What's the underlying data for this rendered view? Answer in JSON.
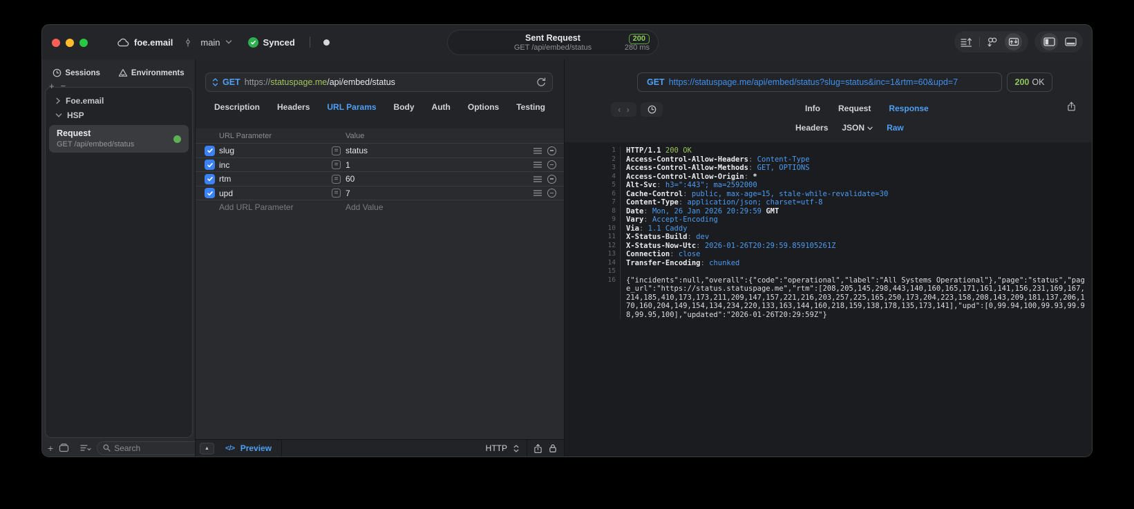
{
  "titlebar": {
    "project": "foe.email",
    "branch": "main",
    "sync_label": "Synced",
    "summary": {
      "title": "Sent Request",
      "subtitle": "GET /api/embed/status",
      "status_code": "200",
      "duration": "280 ms"
    }
  },
  "glyphs": {
    "plus": "+",
    "minus": "−",
    "equals": "=",
    "back": "‹",
    "forward": "›",
    "expand": "▲",
    "code_icon": "</>"
  },
  "sidebar": {
    "tabs": [
      {
        "label": "Sessions"
      },
      {
        "label": "Environments"
      }
    ],
    "active_tab": "Sessions",
    "tree": [
      {
        "label": "Foe.email"
      },
      {
        "label": "HSP"
      }
    ],
    "request_item": {
      "title": "Request",
      "subtitle": "GET /api/embed/status"
    },
    "search_placeholder": "Search"
  },
  "request_panel": {
    "method": "GET",
    "url": {
      "scheme": "https://",
      "host": "statuspage.me",
      "path": "/api/embed/status"
    },
    "tabs": [
      "Description",
      "Headers",
      "URL Params",
      "Body",
      "Auth",
      "Options",
      "Testing"
    ],
    "active_tab": "URL Params",
    "params": {
      "columns": [
        "URL Parameter",
        "Value"
      ],
      "rows": [
        {
          "name": "slug",
          "value": "status",
          "enabled": true
        },
        {
          "name": "inc",
          "value": "1",
          "enabled": true
        },
        {
          "name": "rtm",
          "value": "60",
          "enabled": true
        },
        {
          "name": "upd",
          "value": "7",
          "enabled": true
        }
      ],
      "add_name_placeholder": "Add URL Parameter",
      "add_value_placeholder": "Add Value"
    },
    "footer": {
      "preview": "Preview",
      "protocol": "HTTP"
    }
  },
  "response_panel": {
    "request_line": {
      "method": "GET",
      "url": "https://statuspage.me/api/embed/status?slug=status&inc=1&rtm=60&upd=7"
    },
    "status": {
      "code": "200",
      "text": "OK"
    },
    "tabs": [
      "Info",
      "Request",
      "Response"
    ],
    "active_tab": "Response",
    "subtabs": [
      "Headers",
      "JSON",
      "Raw"
    ],
    "active_subtab": "Raw",
    "status_line": {
      "protocol": "HTTP/1.1",
      "status": "200 OK"
    },
    "headers": [
      {
        "key": "Access-Control-Allow-Headers",
        "value": "Content-Type"
      },
      {
        "key": "Access-Control-Allow-Methods",
        "value": "GET, OPTIONS"
      },
      {
        "key": "Access-Control-Allow-Origin",
        "value": "",
        "tail": "*"
      },
      {
        "key": "Alt-Svc",
        "value": "h3=\":443\"; ma=2592000"
      },
      {
        "key": "Cache-Control",
        "value": "public, max-age=15, stale-while-revalidate=30"
      },
      {
        "key": "Content-Type",
        "value": "application/json; charset=utf-8"
      },
      {
        "key": "Date",
        "value": "Mon, 26 Jan 2026 20:29:59",
        "tail": " GMT"
      },
      {
        "key": "Vary",
        "value": "Accept-Encoding"
      },
      {
        "key": "Via",
        "value": "1.1 Caddy"
      },
      {
        "key": "X-Status-Build",
        "value": "dev"
      },
      {
        "key": "X-Status-Now-Utc",
        "value": "2026-01-26T20:29:59.859105261Z"
      },
      {
        "key": "Connection",
        "value": "close"
      },
      {
        "key": "Transfer-Encoding",
        "value": "chunked"
      }
    ],
    "body": {
      "incidents": null,
      "overall": {
        "code": "operational",
        "label": "All Systems Operational"
      },
      "page": "status",
      "page_url": "https://status.statuspage.me",
      "rtm": [
        208,
        205,
        145,
        298,
        443,
        140,
        160,
        165,
        171,
        161,
        141,
        156,
        231,
        169,
        167,
        214,
        185,
        410,
        173,
        173,
        211,
        209,
        147,
        157,
        221,
        216,
        203,
        257,
        225,
        165,
        250,
        173,
        204,
        223,
        158,
        208,
        143,
        209,
        181,
        137,
        206,
        170,
        160,
        204,
        149,
        154,
        134,
        234,
        220,
        133,
        163,
        144,
        160,
        218,
        159,
        138,
        178,
        135,
        173,
        141
      ],
      "upd": [
        0,
        99.94,
        100,
        99.93,
        99.98,
        99.95,
        100
      ],
      "updated": "2026-01-26T20:29:59Z"
    }
  },
  "colors": {
    "accent": "#4da0f5",
    "success": "#8fc35c",
    "method": "#4da0f5",
    "host_green": "#a6c361",
    "checkbox": "#3b82f6"
  }
}
